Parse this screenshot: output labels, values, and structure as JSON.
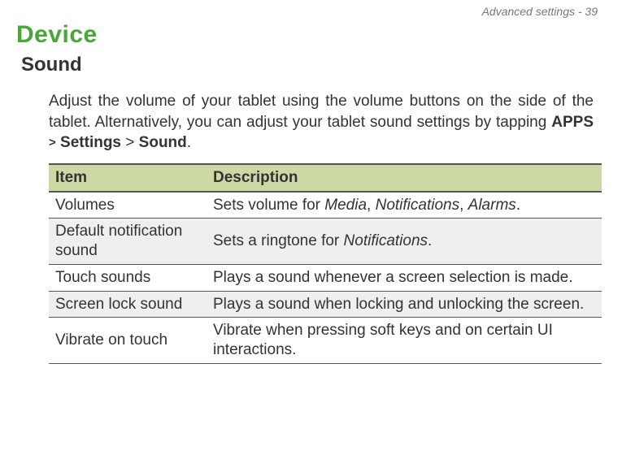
{
  "header": {
    "text": "Advanced settings - 39"
  },
  "headings": {
    "device": "Device",
    "sound": "Sound"
  },
  "intro": {
    "pre": "Adjust the volume of your tablet using the volume buttons on the side of the tablet. Alternatively, you can adjust your tablet sound settings by tapping ",
    "apps": "APPS",
    "gt1": ">",
    "settings": "Settings",
    "gt2": ">",
    "soundword": "Sound",
    "period": "."
  },
  "table": {
    "headers": {
      "item": "Item",
      "description": "Description"
    },
    "rows": [
      {
        "item": "Volumes",
        "desc_pre": "Sets volume for ",
        "terms": [
          "Media",
          "Notifications",
          "Alarms"
        ],
        "sep": ", ",
        "desc_post": "."
      },
      {
        "item": "Default notification sound",
        "desc_pre": "Sets a ringtone for ",
        "terms": [
          "Notifications"
        ],
        "sep": "",
        "desc_post": "."
      },
      {
        "item": "Touch sounds",
        "desc_plain": "Plays a sound whenever a screen selection is made."
      },
      {
        "item": "Screen lock sound",
        "desc_plain": "Plays a sound when locking and unlocking the screen."
      },
      {
        "item": "Vibrate on touch",
        "desc_plain": "Vibrate when pressing soft keys and on certain UI interactions."
      }
    ]
  }
}
